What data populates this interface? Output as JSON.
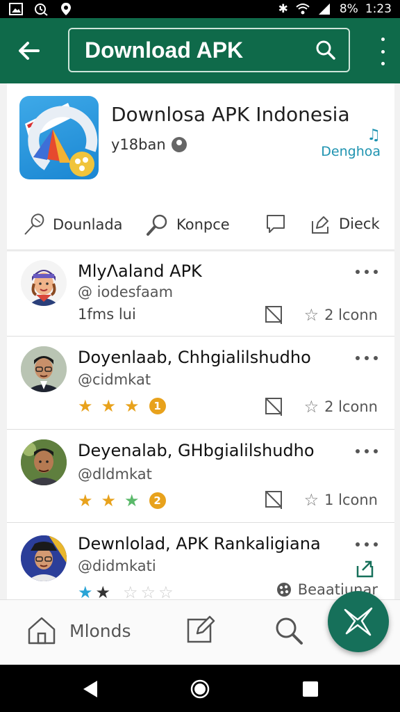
{
  "status_bar": {
    "battery": "8%",
    "time": "1:23"
  },
  "app_bar": {
    "title": "Download APK"
  },
  "app": {
    "name": "Downlosa APK Indonesia",
    "developer": "y18ban",
    "side_link": "Denghoa",
    "actions": [
      {
        "label": "Dounlada",
        "icon": "pin-icon"
      },
      {
        "label": "Konpce",
        "icon": "search-icon"
      },
      {
        "label": "",
        "icon": "comment-icon"
      },
      {
        "label": "Dieck",
        "icon": "share-icon"
      }
    ]
  },
  "list": [
    {
      "name": "MlyΛaland APK",
      "handle": "@ iodesfaam",
      "meta_text": "1fms lui",
      "stars": [],
      "badge": "",
      "right_text": "2 lconn"
    },
    {
      "name": "Doyenlaab, Chhgialilshudho",
      "handle": "@cidmkat",
      "meta_text": "",
      "stars": [
        "gold",
        "gold",
        "gold"
      ],
      "badge": "1",
      "right_text": "2 lconn"
    },
    {
      "name": "Deyenalab, GHbgialilshudho",
      "handle": "@dldmkat",
      "meta_text": "",
      "stars": [
        "gold",
        "gold",
        "green"
      ],
      "badge": "2",
      "right_text": "1 lconn"
    },
    {
      "name": "Dewnlolad, APK Rankaligiana",
      "handle": "@didmkati",
      "meta_text": "",
      "stars": [
        "blue",
        "dark",
        "faint",
        "faint",
        "faint"
      ],
      "badge": "",
      "right_text": "Beaatiunar"
    }
  ],
  "bottom_nav": {
    "home_label": "Mlonds"
  },
  "colors": {
    "primary": "#0f6a4a",
    "accent": "#1e93b0",
    "star_gold": "#e8a21c",
    "fab": "#16705a"
  }
}
